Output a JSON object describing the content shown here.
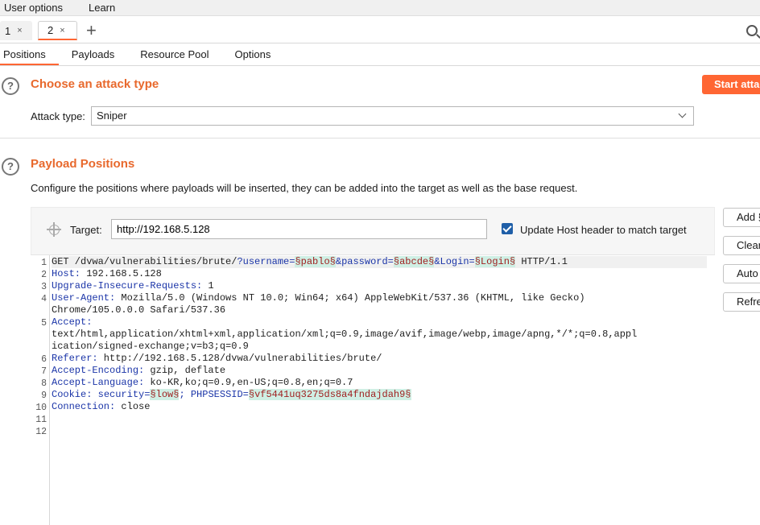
{
  "menu": {
    "items": [
      "User options",
      "Learn"
    ]
  },
  "tabs": [
    {
      "label": "1",
      "close": "×"
    },
    {
      "label": "2",
      "close": "×"
    }
  ],
  "new_tab": "+",
  "subtabs": [
    "Positions",
    "Payloads",
    "Resource Pool",
    "Options"
  ],
  "attack_section": {
    "title": "Choose an attack type",
    "start_button": "Start attack",
    "attack_type_label": "Attack type:",
    "attack_type_value": "Sniper"
  },
  "positions_section": {
    "title": "Payload Positions",
    "description": "Configure the positions where payloads will be inserted, they can be added into the target as well as the base request.",
    "target_label": "Target:",
    "target_value": "http://192.168.5.128",
    "update_host_label": "Update Host header to match target",
    "update_host_checked": true,
    "side_buttons": [
      "Add §",
      "Clear §",
      "Auto §",
      "Refresh"
    ]
  },
  "request": {
    "line_numbers": [
      "1",
      "2",
      "3",
      "4",
      "",
      "5",
      "",
      "",
      "6",
      "7",
      "8",
      "9",
      "10",
      "11",
      "12"
    ],
    "l1": {
      "a": "GET /dvwa/vulnerabilities/brute/",
      "b": "?username=",
      "c": "§pablo§",
      "d": "&password=",
      "e": "§abcde§",
      "f": "&Login=",
      "g": "§Login§",
      "h": " HTTP/1.1"
    },
    "l2": {
      "name": "Host:",
      "value": " 192.168.5.128"
    },
    "l3": {
      "name": "Upgrade-Insecure-Requests:",
      "value": " 1"
    },
    "l4": {
      "name": "User-Agent:",
      "value": " Mozilla/5.0 (Windows NT 10.0; Win64; x64) AppleWebKit/537.36 (KHTML, like Gecko)"
    },
    "l4b": "Chrome/105.0.0.0 Safari/537.36",
    "l5": {
      "name": "Accept:"
    },
    "l5b": "text/html,application/xhtml+xml,application/xml;q=0.9,image/avif,image/webp,image/apng,*/*;q=0.8,appl",
    "l5c": "ication/signed-exchange;v=b3;q=0.9",
    "l6": {
      "name": "Referer:",
      "value": " http://192.168.5.128/dvwa/vulnerabilities/brute/"
    },
    "l7": {
      "name": "Accept-Encoding:",
      "value": " gzip, deflate"
    },
    "l8": {
      "name": "Accept-Language:",
      "value": " ko-KR,ko;q=0.9,en-US;q=0.8,en;q=0.7"
    },
    "l9": {
      "name": "Cookie:",
      "a": " security=",
      "b": "§low§",
      "c": "; PHPSESSID=",
      "d": "§vf5441uq3275ds8a4fndajdah9§"
    },
    "l10": {
      "name": "Connection:",
      "value": " close"
    }
  },
  "colors": {
    "accent": "#ff6633",
    "title": "#e8692d",
    "header_name": "#1b35a8",
    "payload_bg": "#cfefe4",
    "payload_fg": "#a02020"
  }
}
